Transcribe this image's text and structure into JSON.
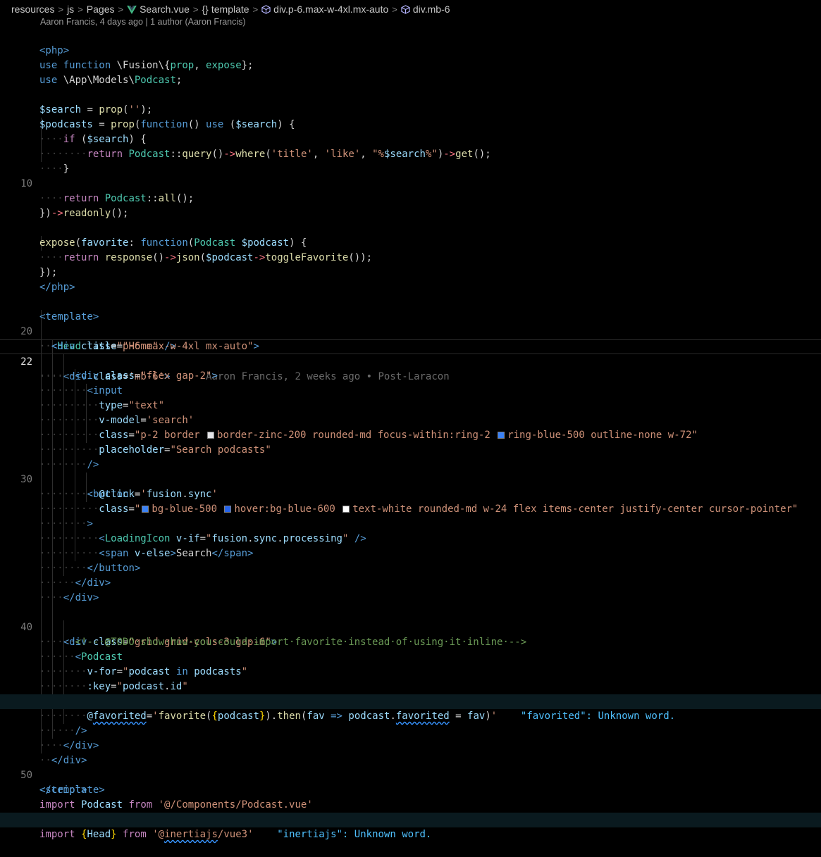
{
  "breadcrumb": {
    "items": [
      "resources",
      "js",
      "Pages",
      "Search.vue",
      "template",
      "div.p-6.max-w-4xl.mx-auto",
      "div.mb-6"
    ],
    "separator": ">",
    "icons": {
      "file": "vue-icon",
      "template": "braces-icon",
      "element": "cube-icon"
    }
  },
  "blame_header": "Aaron Francis, 4 days ago | 1 author (Aaron Francis)",
  "inline_blame": "Aaron Francis, 2 weeks ago • Post-Laracon",
  "diagnostics": {
    "favorited": "\"favorited\": Unknown word.",
    "inertiajs": "\"inertiajs\": Unknown word."
  },
  "line_numbers": {
    "10": "10",
    "20": "20",
    "22": "22",
    "30": "30",
    "40": "40",
    "50": "50"
  },
  "active_line": "22",
  "swatch_colors": {
    "zinc-200": "#e4e4e7",
    "blue-500": "#3b82f6",
    "blue-600": "#2563eb",
    "white": "#ffffff"
  },
  "colors": {
    "background": "#000000",
    "keyword": "#569cd6",
    "string": "#ce9178",
    "function": "#dcdcaa",
    "class": "#4ec9b0",
    "variable": "#9cdcfe",
    "comment": "#6a9955"
  }
}
